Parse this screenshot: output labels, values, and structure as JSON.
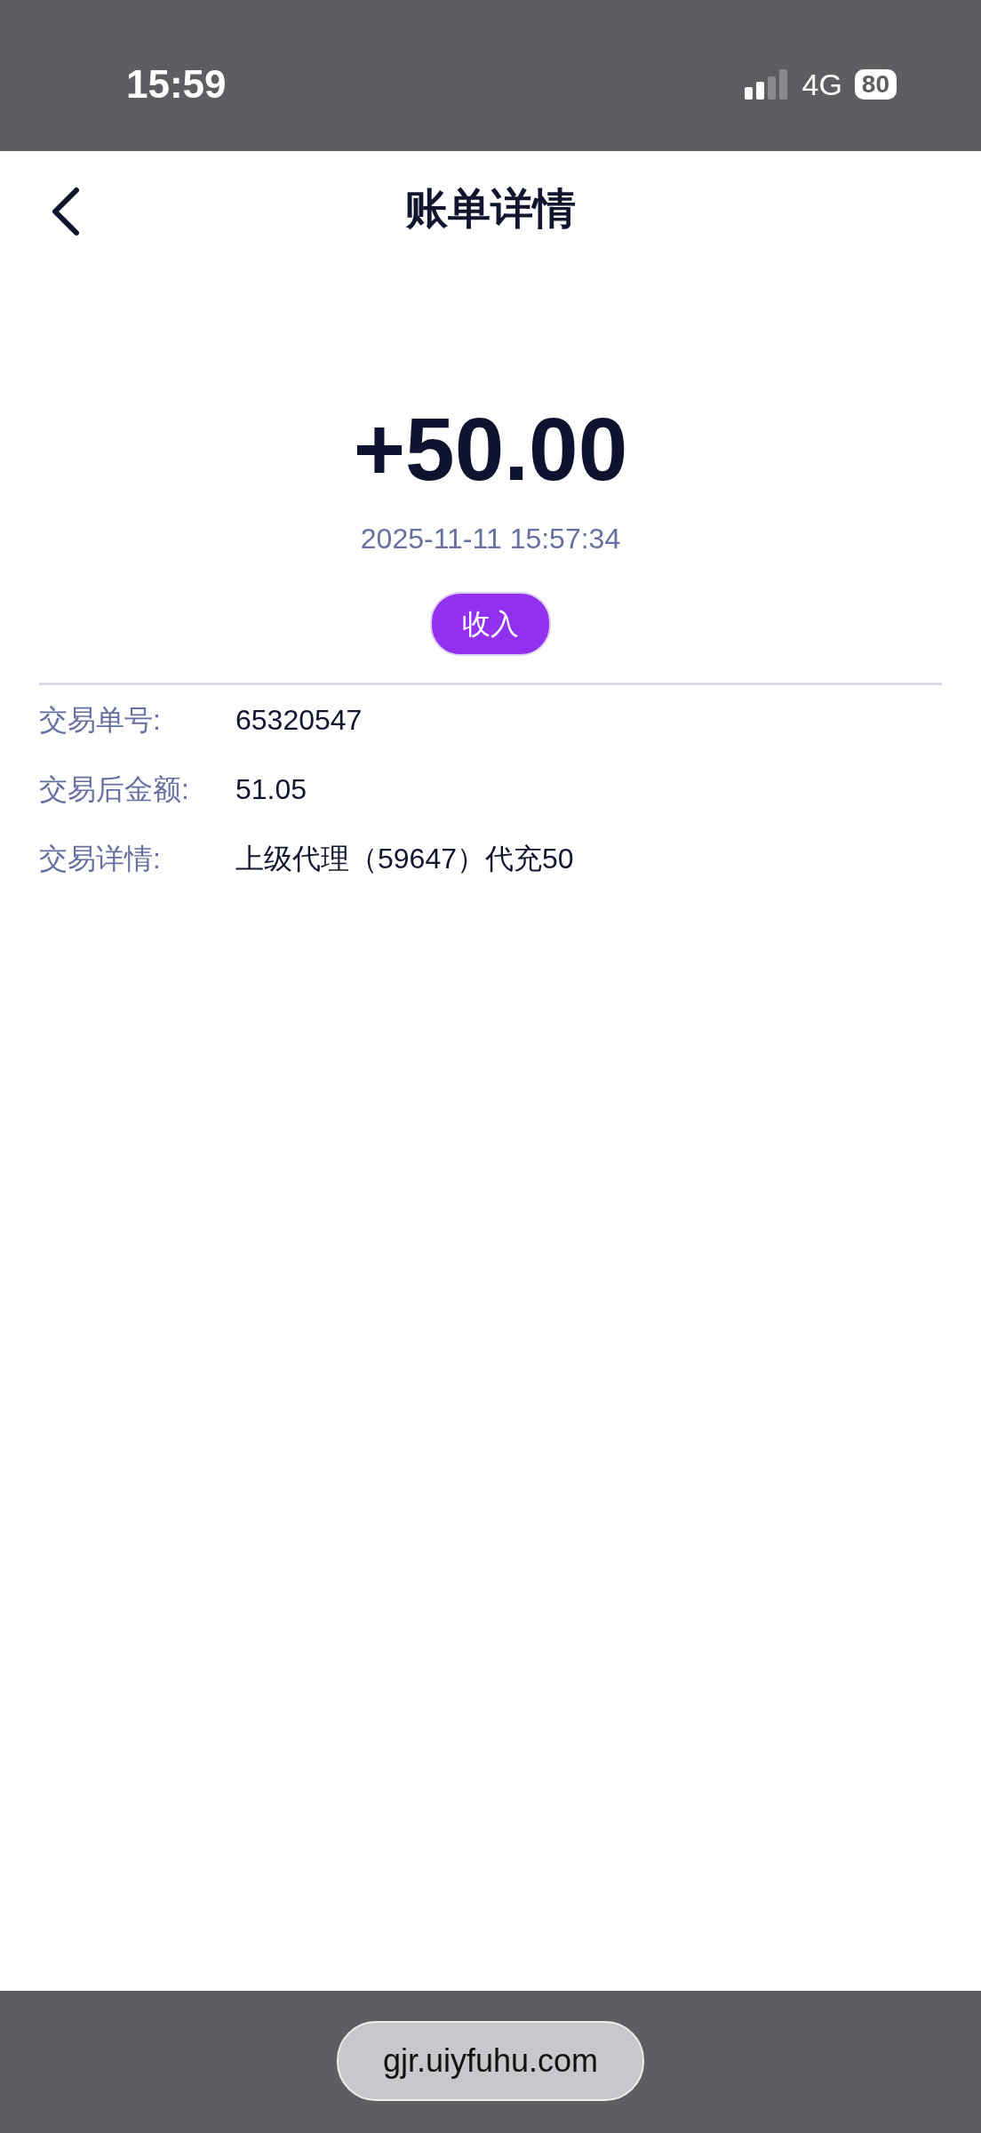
{
  "status_bar": {
    "time": "15:59",
    "network": "4G",
    "battery": "80"
  },
  "header": {
    "title": "账单详情"
  },
  "transaction": {
    "amount": "+50.00",
    "datetime": "2025-11-11 15:57:34",
    "type_badge": "收入"
  },
  "details": [
    {
      "label": "交易单号:",
      "value": "65320547"
    },
    {
      "label": "交易后金额:",
      "value": "51.05"
    },
    {
      "label": "交易详情:",
      "value": "上级代理（59647）代充50"
    }
  ],
  "browser_bar": {
    "url": "gjr.uiyfuhu.com"
  }
}
